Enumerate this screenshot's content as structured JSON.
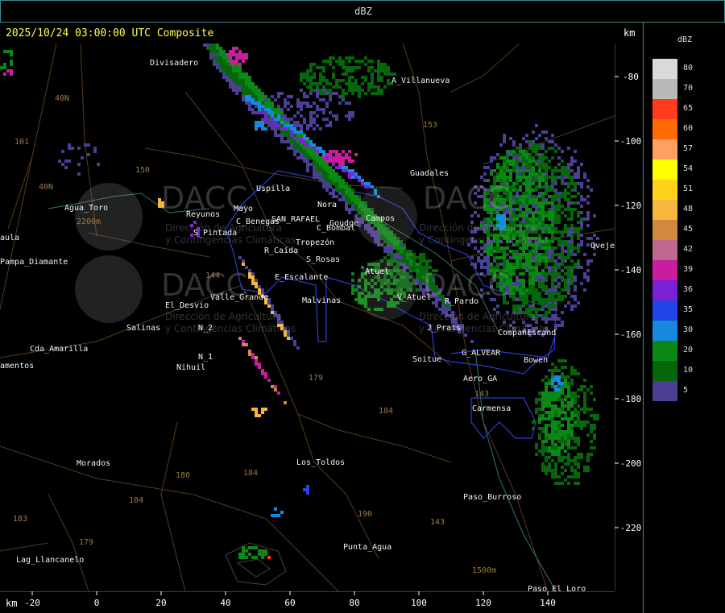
{
  "header": {
    "title": "dBZ"
  },
  "map": {
    "timestamp": "2025/10/24 03:00:00 UTC Composite",
    "unit_top": "km",
    "unit_bottom": "km",
    "x_ticks": [
      -20,
      0,
      20,
      40,
      60,
      80,
      100,
      120,
      140
    ],
    "y_ticks": [
      -80,
      -100,
      -120,
      -140,
      -160,
      -180,
      -200,
      -220
    ],
    "places": [
      "Divisadero",
      "A_Villanueva",
      "Guadales",
      "Uspilla",
      "Nora",
      "Agua_Toro",
      "Reyunos",
      "Mayo",
      "C_Benegas",
      "SAN_RAFAEL",
      "Goudge",
      "C_Bombal",
      "Campos",
      "S_Pintada",
      "Tropezón",
      "R_Caída",
      "S_Rosas",
      "Pampa_Diamante",
      "aula",
      "El_Desvio",
      "Valle_Grande",
      "E_Escalante",
      "Malvinas",
      "Atuel",
      "V_Atuel",
      "R_Pardo",
      "Salinas",
      "N_2",
      "N_1",
      "Nihuil",
      "J_Prats",
      "G_ALVEAR",
      "CompañEscand",
      "Soitue",
      "Bowen",
      "Aero_GA",
      "Carmensa",
      "Cda_Amarilla",
      "amentos",
      "Morados",
      "Los_Toldos",
      "Paso_Burroso",
      "Lag_Llancanelo",
      "Punta_Agua",
      "Paso_El_Loro",
      "Ovejería"
    ],
    "routes": [
      "40N",
      "40N",
      "101",
      "150",
      "153",
      "144",
      "179",
      "184",
      "180",
      "184",
      "184",
      "183",
      "179",
      "190",
      "143",
      "143",
      "1500m",
      "2200m"
    ],
    "watermark": {
      "brand": "DACC",
      "line1": "Dirección de Agricultura",
      "line2": "y Contingencias Climáticas"
    }
  },
  "legend": {
    "title": "dBZ",
    "items": [
      {
        "value": "80",
        "color": "#d9d9d9"
      },
      {
        "value": "70",
        "color": "#b9b9b9"
      },
      {
        "value": "65",
        "color": "#ff3d1d"
      },
      {
        "value": "60",
        "color": "#ff6a05"
      },
      {
        "value": "57",
        "color": "#ffa060"
      },
      {
        "value": "54",
        "color": "#ffff00"
      },
      {
        "value": "51",
        "color": "#ffd21e"
      },
      {
        "value": "48",
        "color": "#f5b73c"
      },
      {
        "value": "45",
        "color": "#d2893f"
      },
      {
        "value": "42",
        "color": "#c0688e"
      },
      {
        "value": "39",
        "color": "#c71d9e"
      },
      {
        "value": "36",
        "color": "#7d20d4"
      },
      {
        "value": "35",
        "color": "#2044e6"
      },
      {
        "value": "30",
        "color": "#158ae0"
      },
      {
        "value": "20",
        "color": "#0a8a14"
      },
      {
        "value": "10",
        "color": "#05660c"
      },
      {
        "value": "5",
        "color": "#4a3f94"
      }
    ]
  }
}
